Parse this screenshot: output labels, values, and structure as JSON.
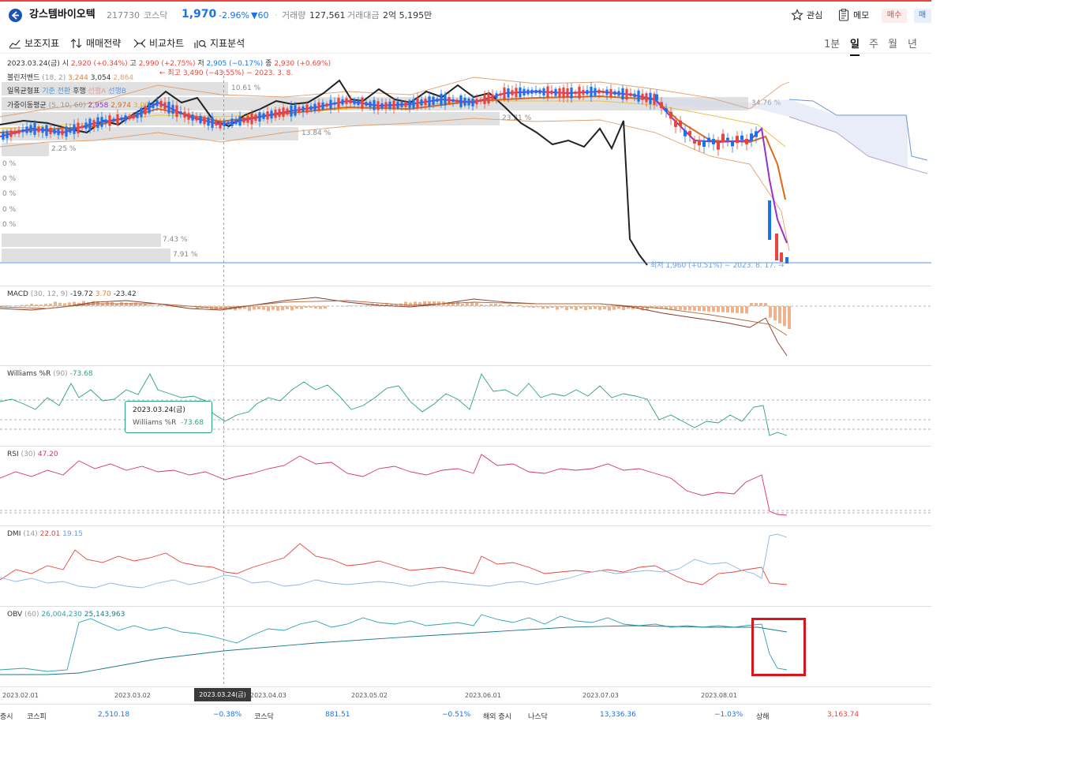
{
  "header": {
    "name": "강스템바이오텍",
    "code": "217730",
    "market": "코스닥",
    "price": "1,970",
    "change_pct": "-2.96%",
    "change_amt": "▼60",
    "volume_label": "거래량",
    "volume": "127,561",
    "trade_value_label": "거래대금",
    "trade_value": "2억 5,195만",
    "interest_label": "관심",
    "memo_label": "메모",
    "buy_label": "매수",
    "sell_label": "매도",
    "colors": {
      "up": "#e8453c",
      "down": "#1a73e8"
    }
  },
  "toolbar": {
    "indicators": "보조지표",
    "strategy": "매매전략",
    "compare": "비교차트",
    "analysis": "지표분석",
    "periods": [
      "1분",
      "일",
      "주",
      "월",
      "년"
    ],
    "active_period": "일"
  },
  "price_legend": {
    "date": "2023.03.24(금)",
    "open_label": "시",
    "open": "2,920 (+0.34%)",
    "high_label": "고",
    "high": "2,990 (+2.75%)",
    "low_label": "저",
    "low": "2,905 (−0.17%)",
    "close_label": "종",
    "close": "2,930 (+0.69%)",
    "bollinger_label": "볼린저밴드",
    "bollinger_params": "(18, 2)",
    "boll_upper": "3,244",
    "boll_mid": "3,054",
    "boll_lower": "2,864",
    "ichimoku_label": "일목균형표",
    "ichimoku_base": "기준",
    "ichimoku_conv": "전환",
    "ichimoku_lag": "후행",
    "ichimoku_spanA": "선행A",
    "ichimoku_spanB": "선행B",
    "ma_label": "가중이동평균",
    "ma_params": "(5, 10, 60)",
    "ma5": "2,958",
    "ma10": "2,974",
    "ma60": "3,07",
    "max_note": "← 최고 3,490 (−43.55%) − 2023. 3. 8.",
    "min_note": "최저 1,960 (+0.51%) − 2023. 8. 17. →"
  },
  "volume_profile": [
    "10.61 %",
    "34.76 %",
    "23.21 %",
    "13.84 %",
    "2.25 %",
    "0 %",
    "0 %",
    "0 %",
    "0 %",
    "0 %",
    "7.43 %",
    "7.91 %"
  ],
  "indicators": {
    "macd": {
      "label": "MACD",
      "params": "(30, 12, 9)",
      "v1": "-19.72",
      "v2": "3.70",
      "v3": "-23.42"
    },
    "williams": {
      "label": "Williams %R",
      "params": "(90)",
      "value": "-73.68"
    },
    "rsi": {
      "label": "RSI",
      "params": "(30)",
      "value": "47.20"
    },
    "dmi": {
      "label": "DMI",
      "params": "(14)",
      "v1": "22.01",
      "v2": "19.15"
    },
    "obv": {
      "label": "OBV",
      "params": "(60)",
      "v1": "26,004,230",
      "v2": "25,143,963"
    }
  },
  "tooltip": {
    "date": "2023.03.24(금)",
    "label": "Williams %R",
    "value": "-73.68"
  },
  "xaxis": {
    "labels": [
      "2023.02.01",
      "2023.03.02",
      "2023.04.03",
      "2023.05.02",
      "2023.06.01",
      "2023.07.03",
      "2023.08.01"
    ],
    "cursor_label": "2023.03.24(금)"
  },
  "bottom_ticker": {
    "items": [
      {
        "label": "증시",
        "value": ""
      },
      {
        "label": "코스피",
        "value": "2,510.18"
      },
      {
        "label": "",
        "value": "−0.38%"
      },
      {
        "label": "코스닥",
        "value": "881.51"
      },
      {
        "label": "",
        "value": "−0.51%"
      },
      {
        "label": "해외 증시",
        "value": ""
      },
      {
        "label": "나스닥",
        "value": "13,336.36"
      },
      {
        "label": "",
        "value": "−1.03%"
      },
      {
        "label": "상해",
        "value": "3,163.74"
      }
    ]
  },
  "chart_data": {
    "type": "line",
    "x_labels": [
      "2023.02.01",
      "2023.03.02",
      "2023.04.03",
      "2023.05.02",
      "2023.06.01",
      "2023.07.03",
      "2023.08.01"
    ],
    "series": [
      {
        "name": "종",
        "values": [
          2800,
          3000,
          3100,
          3200,
          3300,
          3250,
          2900,
          1970
        ]
      }
    ]
  }
}
